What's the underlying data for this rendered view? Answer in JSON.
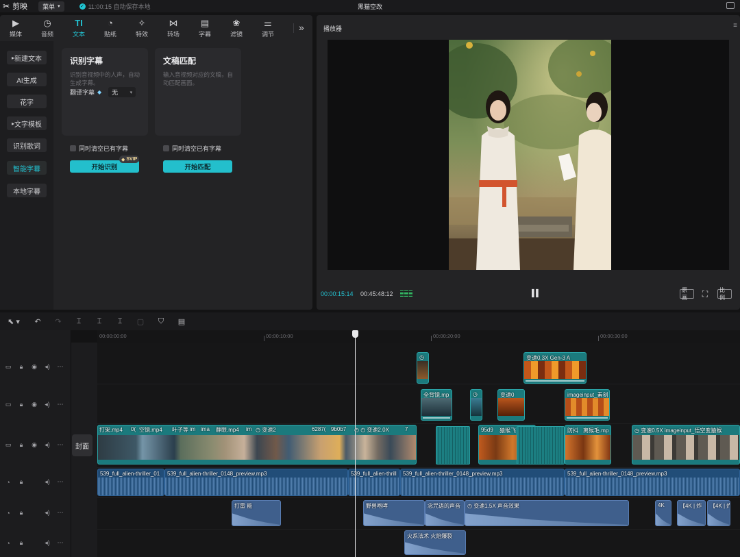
{
  "app": {
    "logo_text": "剪映",
    "menu_label": "菜单",
    "save_status": "11:00:15 自动保存本地",
    "project_title": "黑猫空改"
  },
  "tabs": [
    {
      "label": "媒体",
      "icon": "media-icon",
      "glyph": "▶"
    },
    {
      "label": "音频",
      "icon": "audio-icon",
      "glyph": "◷"
    },
    {
      "label": "文本",
      "icon": "text-icon",
      "glyph": "TI",
      "active": true
    },
    {
      "label": "贴纸",
      "icon": "sticker-icon",
      "glyph": "◔"
    },
    {
      "label": "特效",
      "icon": "effects-icon",
      "glyph": "✧"
    },
    {
      "label": "转场",
      "icon": "transition-icon",
      "glyph": "⋈"
    },
    {
      "label": "字幕",
      "icon": "subtitle-icon",
      "glyph": "▤"
    },
    {
      "label": "滤镜",
      "icon": "filter-icon",
      "glyph": "❀"
    },
    {
      "label": "调节",
      "icon": "adjust-icon",
      "glyph": "⚌"
    }
  ],
  "sidebar": [
    {
      "label": "新建文本",
      "caret": true
    },
    {
      "label": "AI生成"
    },
    {
      "label": "花字"
    },
    {
      "label": "文字模板",
      "caret": true
    },
    {
      "label": "识别歌词"
    },
    {
      "label": "智能字幕",
      "active": true
    },
    {
      "label": "本地字幕"
    }
  ],
  "card_recognize": {
    "title": "识别字幕",
    "desc": "识别音视频中的人声，自动生成字幕。",
    "translate_label": "翻译字幕",
    "translate_value": "无",
    "clear_label": "同时清空已有字幕",
    "vip_badge": "SVIP",
    "button": "开始识别"
  },
  "card_match": {
    "title": "文稿匹配",
    "desc": "输入音视频对应的文稿，自动匹配画面。",
    "clear_label": "同时清空已有字幕",
    "button": "开始匹配"
  },
  "player": {
    "title": "播放器",
    "current_time": "00:00:15:14",
    "total_time": "00:45:48:12",
    "btn_original": "原画",
    "btn_ratio": "比例"
  },
  "timeline": {
    "ruler": [
      "00:00:00:00",
      "00:00:10:00",
      "00:00:20:00",
      "00:00:30:00"
    ],
    "cover_label": "封面"
  },
  "clips": {
    "v3": [
      {
        "label": "变速0.3X  Gen-3 A"
      }
    ],
    "v2": [
      {
        "label": "全背镜.mp"
      },
      {
        "label": "变速0"
      },
      {
        "label": "imageinput_素刻"
      }
    ],
    "v1": [
      {
        "label": "打架.mp4"
      },
      {
        "label": "0("
      },
      {
        "label": "空镜.mp4"
      },
      {
        "label": "叶子等"
      },
      {
        "label": "im"
      },
      {
        "label": "ima"
      },
      {
        "label": "静眼.mp4"
      },
      {
        "label": "im"
      },
      {
        "label": "变速2"
      },
      {
        "label": "6287("
      },
      {
        "label": "9b0b7"
      },
      {
        "label": "变速2.0X"
      },
      {
        "label": "7"
      },
      {
        "label": "95d9"
      },
      {
        "label": "猿猴飞"
      },
      {
        "label": "防抖"
      },
      {
        "label": "离猴毛.mp"
      },
      {
        "label": "变速0.5X  imageinput_悟空变猿猴"
      }
    ],
    "audio": [
      {
        "label": "539_full_alien-thriller_01"
      },
      {
        "label": "539_full_alien-thriller_0148_preview.mp3"
      },
      {
        "label": "539_full_alien-thrill"
      },
      {
        "label": "539_full_alien-thriller_0148_preview.mp3"
      },
      {
        "label": "539_full_alien-thriller_0148_preview.mp3"
      }
    ],
    "sfx1": [
      {
        "label": "打雷 能"
      },
      {
        "label": "野兽咆哮"
      },
      {
        "label": "念咒语的声音"
      },
      {
        "label": "变速1.5X  声音效果"
      },
      {
        "label": "4K"
      },
      {
        "label": "【4K | 炸"
      },
      {
        "label": "【4K | 炸"
      }
    ],
    "sfx2": [
      {
        "label": "火系法术 火焰爆裂"
      }
    ]
  }
}
